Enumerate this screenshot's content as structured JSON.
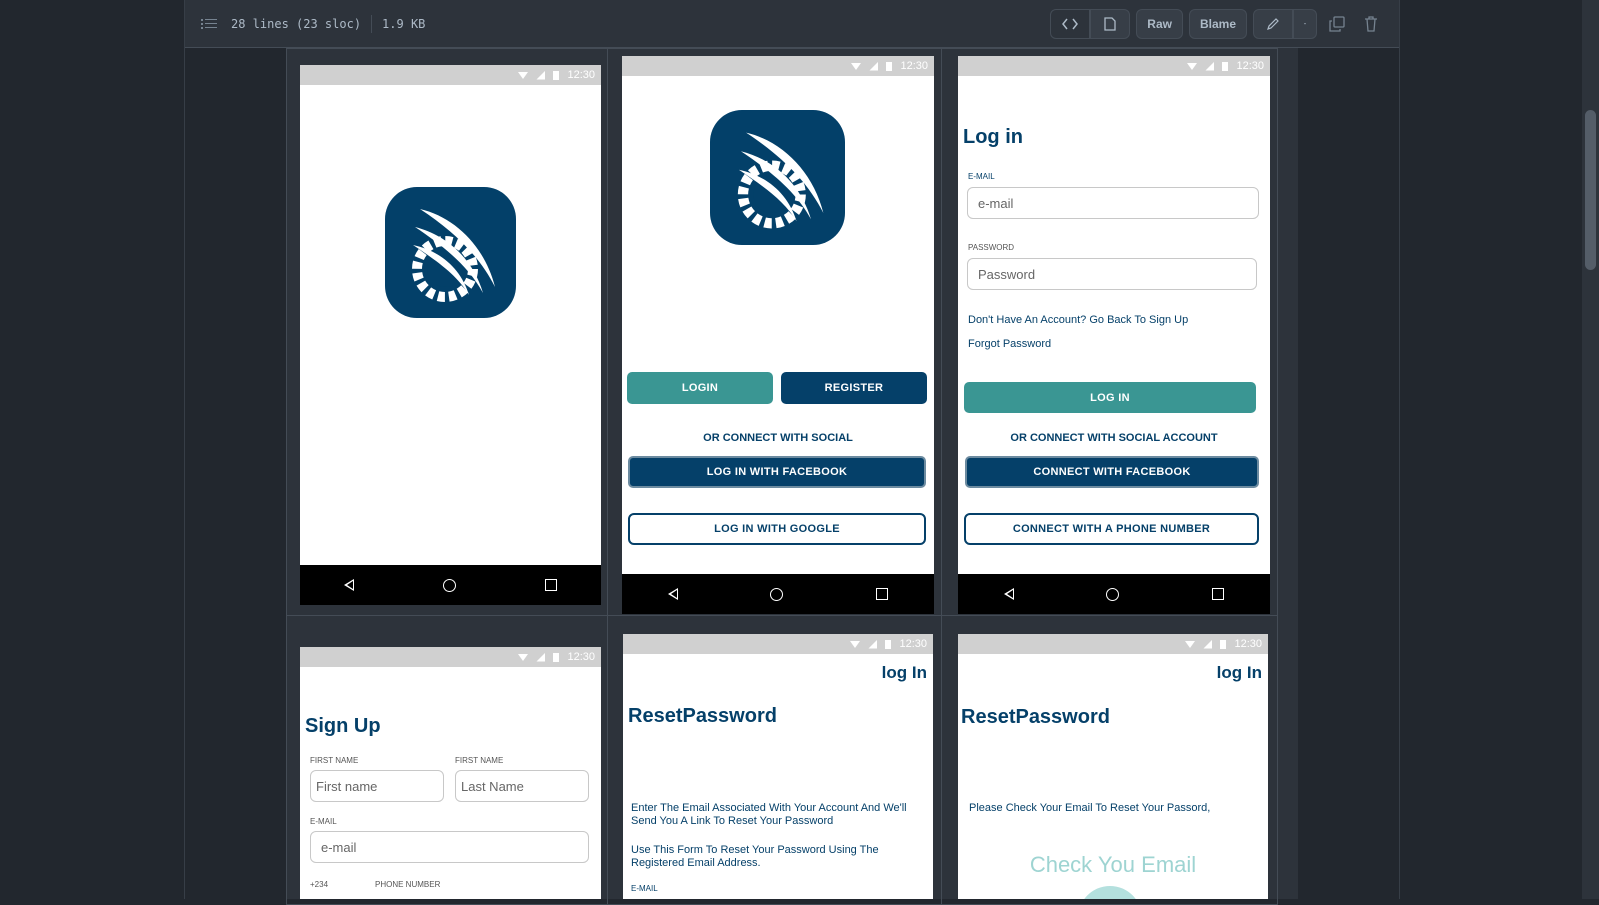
{
  "file": {
    "lines": "28 lines (23 sloc)",
    "size": "1.9 KB"
  },
  "toolbar": {
    "raw": "Raw",
    "blame": "Blame"
  },
  "status": {
    "time": "12:30"
  },
  "screen_welcome": {
    "login": "LOGIN",
    "register": "REGISTER",
    "or_social": "OR  CONNECT WITH SOCIAL",
    "facebook": "LOG IN WITH FACEBOOK",
    "google": "LOG IN WITH GOOGLE"
  },
  "screen_login": {
    "title": "Log in",
    "email_label": "E-MAIL",
    "email_placeholder": "e-mail",
    "password_label": "PASSWORD",
    "password_placeholder": "Password",
    "no_account": "Don't Have An Account? Go Back To Sign Up",
    "forgot": "Forgot Password",
    "login_btn": "LOG IN",
    "or_social": "OR  CONNECT WITH SOCIAL ACCOUNT",
    "facebook": "CONNECT WITH FACEBOOK",
    "phone": "CONNECT WITH A PHONE NUMBER"
  },
  "screen_signup": {
    "title": "Sign Up",
    "first_label": "FIRST NAME",
    "first_placeholder": "First name",
    "last_label": "FIRST NAME",
    "last_placeholder": "Last Name",
    "email_label": "E-MAIL",
    "email_placeholder": "e-mail",
    "code": "+234",
    "phone_label": "PHONE NUMBER"
  },
  "screen_reset": {
    "login_link": "log In",
    "title": "ResetPassword",
    "para1": "Enter The Email Associated With Your Account And We'll Send You A Link To Reset Your Password",
    "para2": "Use This Form To Reset Your Password Using The Registered Email Address.",
    "email_label": "E-MAIL"
  },
  "screen_check": {
    "login_link": "log In",
    "title": "ResetPassword",
    "para": "Please Check Your Email To Reset Your Passord,",
    "check": "Check You Email"
  },
  "colors": {
    "navy": "#054069",
    "teal": "#3a9693",
    "statusbar": "#d0d0d0"
  }
}
